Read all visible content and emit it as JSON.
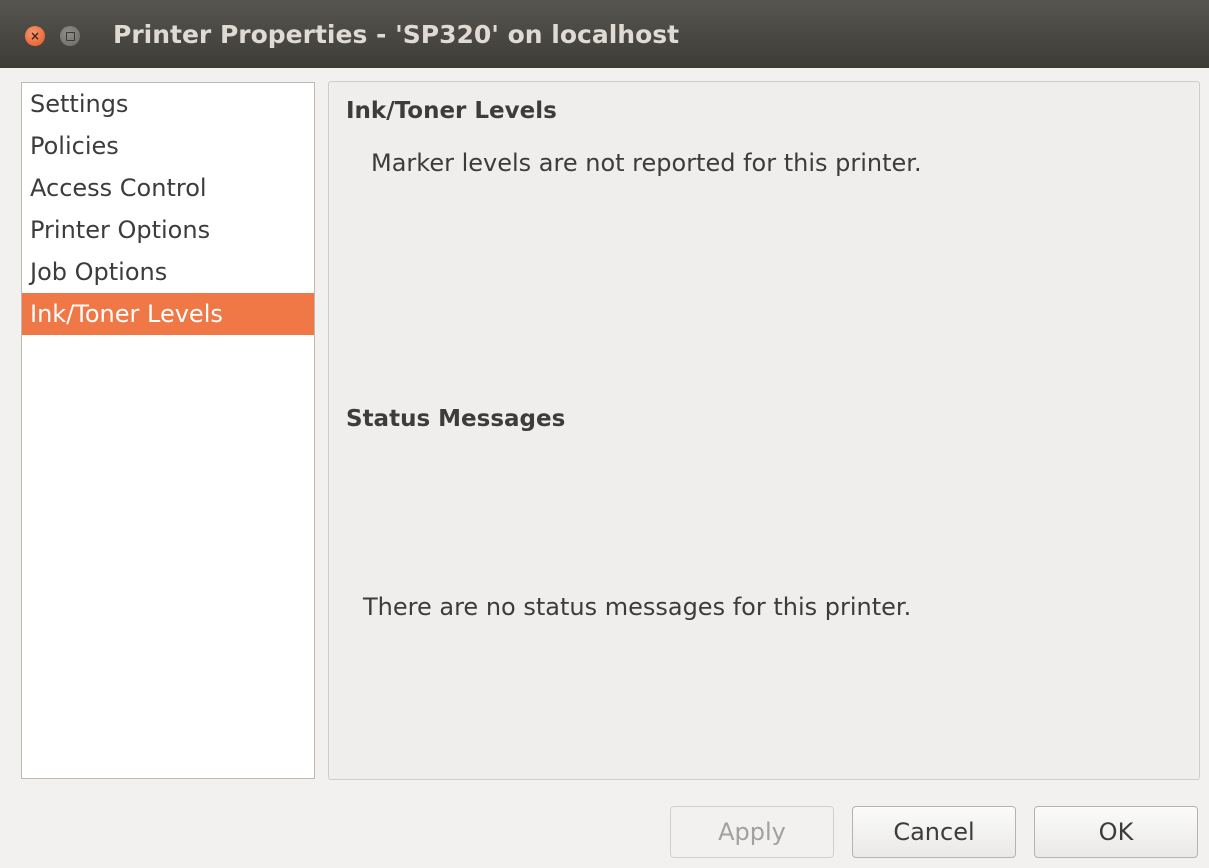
{
  "window": {
    "title": "Printer Properties - 'SP320' on localhost",
    "close_glyph": "×"
  },
  "sidebar": {
    "items": [
      {
        "label": "Settings",
        "selected": false
      },
      {
        "label": "Policies",
        "selected": false
      },
      {
        "label": "Access Control",
        "selected": false
      },
      {
        "label": "Printer Options",
        "selected": false
      },
      {
        "label": "Job Options",
        "selected": false
      },
      {
        "label": "Ink/Toner Levels",
        "selected": true
      }
    ]
  },
  "panel": {
    "ink_heading": "Ink/Toner Levels",
    "marker_message": "Marker levels are not reported for this printer.",
    "status_heading": "Status Messages",
    "status_message": "There are no status messages for this printer."
  },
  "buttons": {
    "apply": {
      "label": "Apply",
      "enabled": false
    },
    "cancel": {
      "label": "Cancel",
      "enabled": true
    },
    "ok": {
      "label": "OK",
      "enabled": true
    }
  },
  "colors": {
    "accent": "#f07746",
    "titlebar": "#3d3c37",
    "title_text": "#dfdbd2",
    "background": "#f2f1f0"
  }
}
